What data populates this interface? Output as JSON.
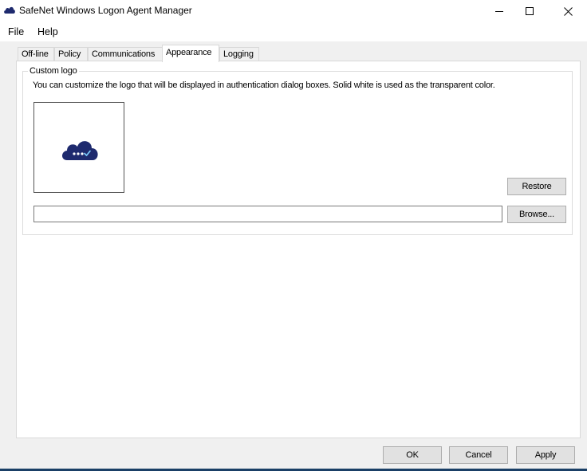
{
  "window": {
    "title": "SafeNet Windows Logon Agent Manager",
    "icon": "cloud-icon",
    "minimize_icon": "minimize-icon",
    "maximize_icon": "maximize-icon",
    "close_icon": "close-icon"
  },
  "menu": {
    "items": [
      {
        "label": "File"
      },
      {
        "label": "Help"
      }
    ]
  },
  "tabs": [
    {
      "label": "Off-line",
      "active": false
    },
    {
      "label": "Policy",
      "active": false
    },
    {
      "label": "Communications",
      "active": false
    },
    {
      "label": "Appearance",
      "active": true
    },
    {
      "label": "Logging",
      "active": false
    }
  ],
  "appearance": {
    "group_title": "Custom logo",
    "description": "You can customize the logo that will be displayed in authentication dialog boxes. Solid white is used as the transparent color.",
    "logo_icon": "cloud-password-icon",
    "restore_label": "Restore",
    "path_value": "",
    "browse_label": "Browse..."
  },
  "footer": {
    "ok_label": "OK",
    "cancel_label": "Cancel",
    "apply_label": "Apply"
  },
  "colors": {
    "brand": "#1e2a6e",
    "accent": "#1a3f66"
  }
}
